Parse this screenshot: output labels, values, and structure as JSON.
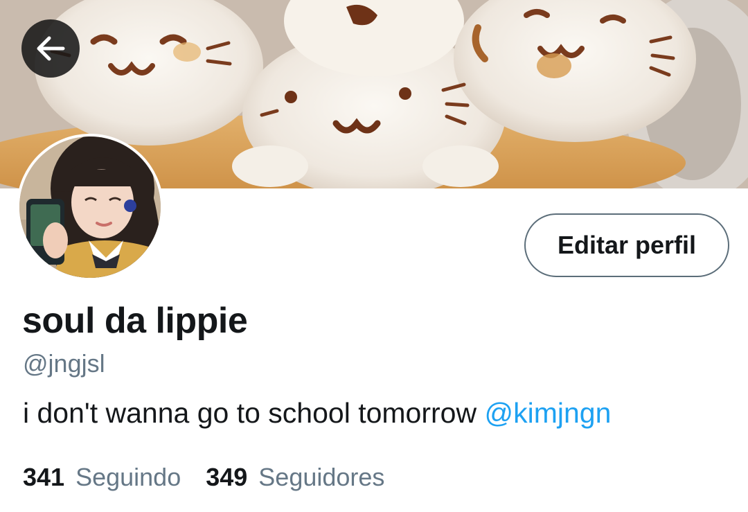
{
  "header": {
    "back_icon": "arrow-left-icon"
  },
  "profile": {
    "display_name": "soul da lippie",
    "handle": "@jngjsl",
    "bio_text": "i don't wanna go to school tomorrow",
    "bio_mention": "@kimjngn",
    "edit_button_label": "Editar perfil"
  },
  "stats": {
    "following_count": "341",
    "following_label": "Seguindo",
    "followers_count": "349",
    "followers_label": "Seguidores"
  },
  "colors": {
    "text_primary": "#14171a",
    "text_secondary": "#657786",
    "link": "#1da1f2",
    "button_border": "#5b6d79"
  }
}
